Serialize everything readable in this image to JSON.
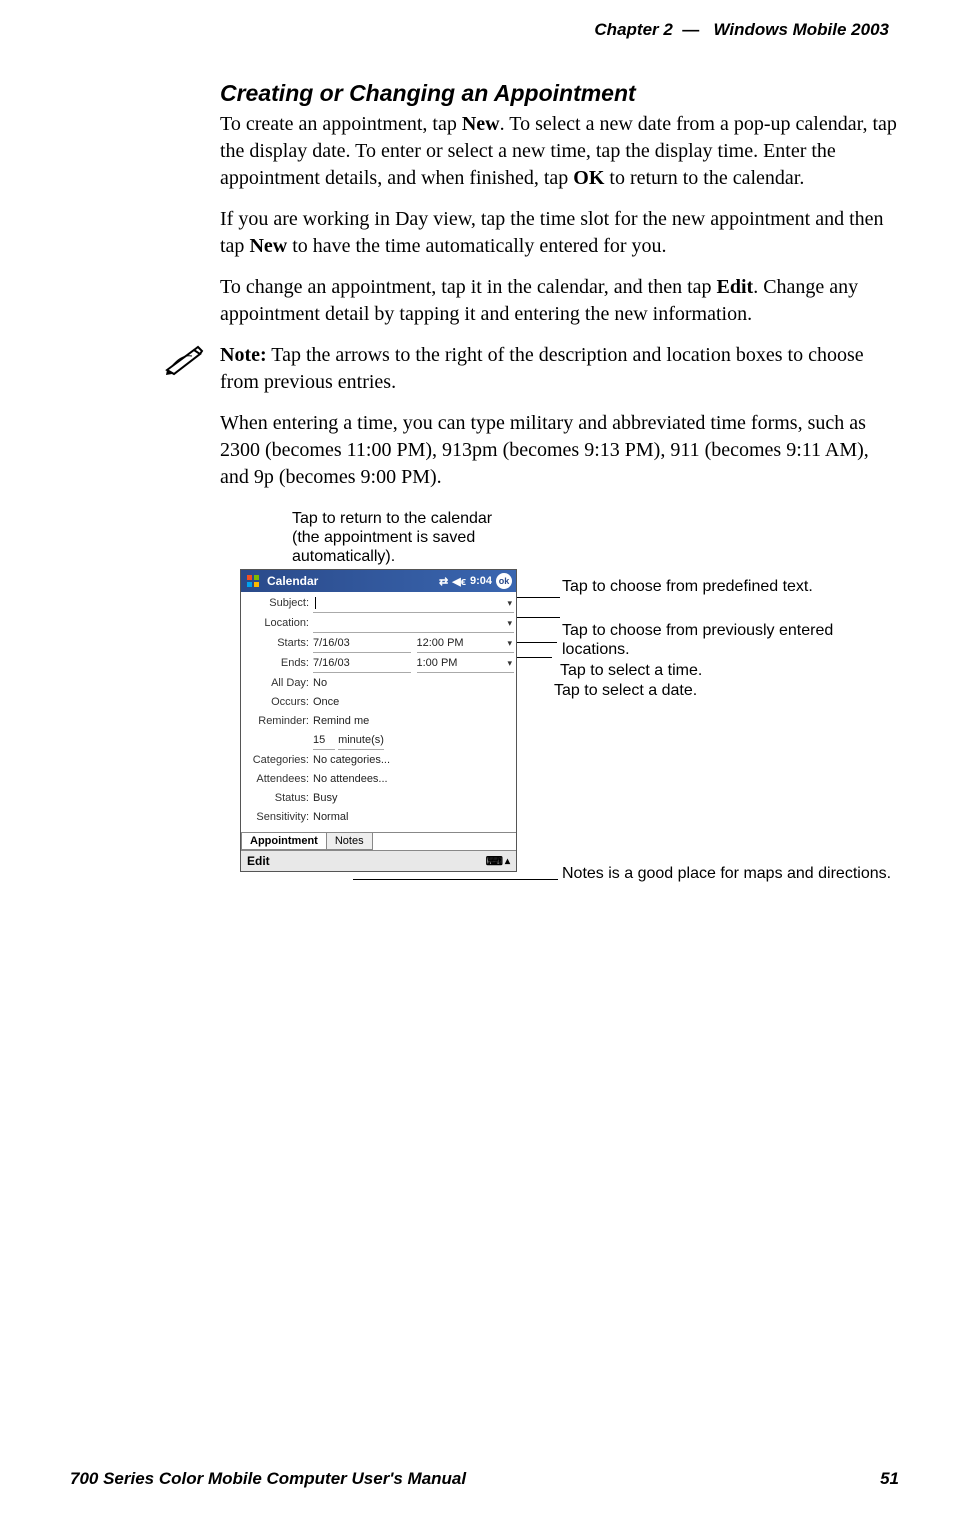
{
  "header": {
    "chapter": "Chapter 2",
    "dash": "—",
    "book_section": "Windows Mobile 2003"
  },
  "section": {
    "title": "Creating or Changing an Appointment",
    "p1_pre": "To create an appointment, tap ",
    "p1_b1": "New",
    "p1_mid": ". To select a new date from a pop-up calendar, tap the display date. To enter or select a new time, tap the display time. Enter the appointment details, and when finished, tap ",
    "p1_b2": "OK",
    "p1_post": " to return to the calendar.",
    "p2_pre": "If you are working in Day view, tap the time slot for the new appointment and then tap ",
    "p2_b1": "New",
    "p2_post": " to have the time automatically entered for you.",
    "p3_pre": "To change an appointment, tap it in the calendar, and then tap ",
    "p3_b1": "Edit",
    "p3_post": ". Change any appointment detail by tapping it and entering the new information.",
    "note_b": "Note:",
    "note_text": " Tap the arrows to the right of the description and location boxes to choose from previous entries.",
    "p4": "When entering a time, you can type military and abbreviated time forms, such as 2300 (becomes 11:00 PM), 913pm (becomes 9:13 PM), 911 (becomes 9:11 AM), and 9p (becomes 9:00 PM)."
  },
  "callouts": {
    "top": "Tap to return to the calendar (the appointment is saved automatically).",
    "predefined": "Tap to choose from predefined text.",
    "locations": "Tap to choose from previously entered locations.",
    "time": "Tap to select a time.",
    "date": "Tap to select a date.",
    "notes": "Notes is a good place for maps and directions."
  },
  "pda": {
    "title": "Calendar",
    "clock": "9:04",
    "ok": "ok",
    "labels": {
      "subject": "Subject:",
      "location": "Location:",
      "starts": "Starts:",
      "ends": "Ends:",
      "allday": "All Day:",
      "occurs": "Occurs:",
      "reminder": "Reminder:",
      "categories": "Categories:",
      "attendees": "Attendees:",
      "status": "Status:",
      "sensitivity": "Sensitivity:"
    },
    "values": {
      "start_date": "7/16/03",
      "start_time": "12:00 PM",
      "end_date": "7/16/03",
      "end_time": "1:00 PM",
      "allday": "No",
      "occurs": "Once",
      "reminder1": "Remind me",
      "reminder_qty": "15",
      "reminder_unit": "minute(s)",
      "categories": "No categories...",
      "attendees": "No attendees...",
      "status": "Busy",
      "sensitivity": "Normal"
    },
    "tabs": {
      "appointment": "Appointment",
      "notes": "Notes"
    },
    "menu": {
      "edit": "Edit"
    }
  },
  "footer": {
    "manual": "700 Series Color Mobile Computer User's Manual",
    "page": "51"
  }
}
